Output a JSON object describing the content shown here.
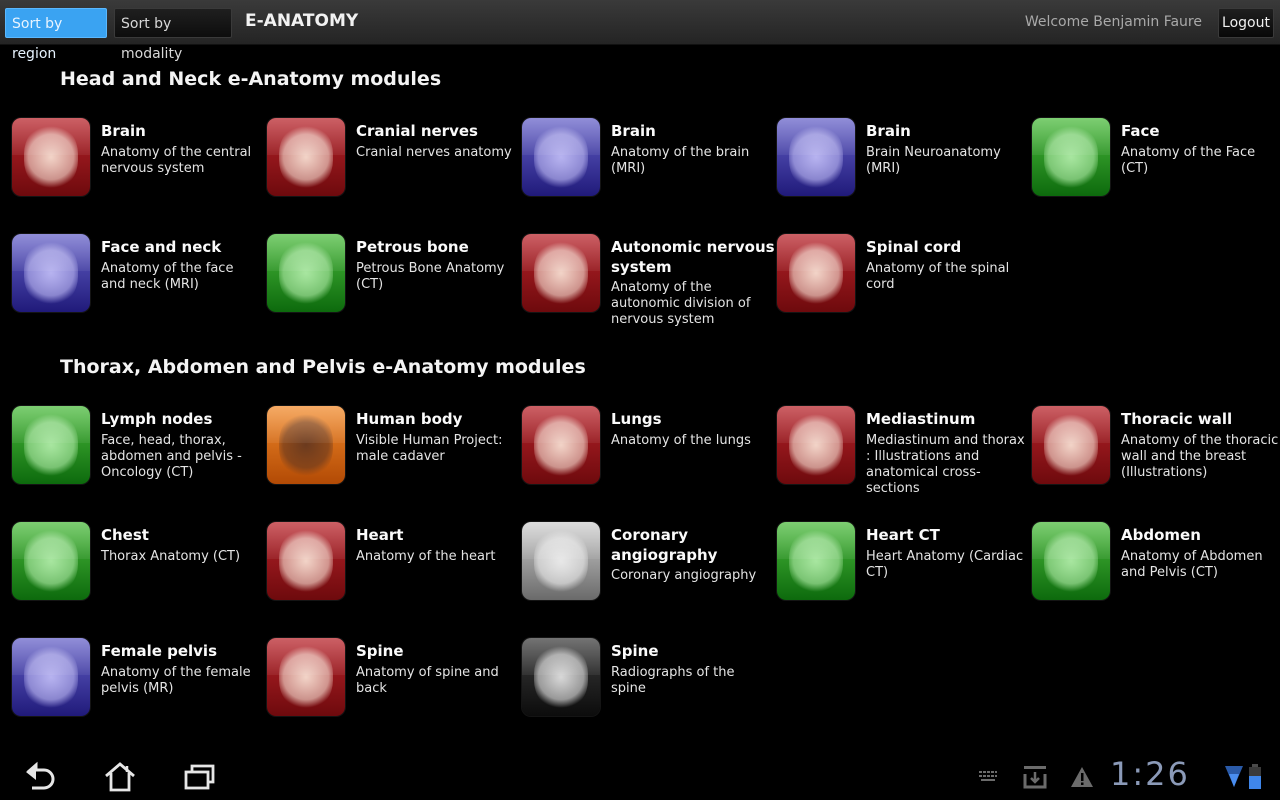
{
  "topbar": {
    "sort_by_region": "Sort by region",
    "sort_by_modality": "Sort by modality",
    "app_title": "E-ANATOMY",
    "welcome": "Welcome Benjamin Faure",
    "logout": "Logout",
    "active_tab_color": "#3aa3f2"
  },
  "sections": [
    {
      "title": "Head and Neck e-Anatomy modules",
      "modules": [
        {
          "title": "Brain",
          "desc": "Anatomy of the central nervous system",
          "icon": "brain-illustration-icon",
          "color": "red"
        },
        {
          "title": "Cranial nerves",
          "desc": "Cranial nerves anatomy",
          "icon": "cranial-nerves-icon",
          "color": "red"
        },
        {
          "title": "Brain",
          "desc": "Anatomy of the brain (MRI)",
          "icon": "brain-mri-sagittal-icon",
          "color": "blue"
        },
        {
          "title": "Brain",
          "desc": "Brain Neuroanatomy (MRI)",
          "icon": "brain-mri-axial-icon",
          "color": "blue"
        },
        {
          "title": "Face",
          "desc": "Anatomy of the Face (CT)",
          "icon": "face-ct-icon",
          "color": "green"
        },
        {
          "title": "Face and neck",
          "desc": "Anatomy of the face and neck (MRI)",
          "icon": "face-neck-mri-icon",
          "color": "blue"
        },
        {
          "title": "Petrous bone",
          "desc": "Petrous Bone Anatomy (CT)",
          "icon": "petrous-bone-ct-icon",
          "color": "green"
        },
        {
          "title": "Autonomic nervous system",
          "desc": "Anatomy of the autonomic division of nervous system",
          "icon": "autonomic-nervous-icon",
          "color": "red"
        },
        {
          "title": "Spinal cord",
          "desc": "Anatomy of the spinal cord",
          "icon": "spinal-cord-icon",
          "color": "red"
        }
      ]
    },
    {
      "title": "Thorax, Abdomen and Pelvis e-Anatomy modules",
      "modules": [
        {
          "title": "Lymph nodes",
          "desc": "Face, head, thorax, abdomen and pelvis - Oncology (CT)",
          "icon": "lymph-nodes-ct-icon",
          "color": "green"
        },
        {
          "title": "Human body",
          "desc": "Visible Human Project: male cadaver",
          "icon": "human-body-icon",
          "color": "orange"
        },
        {
          "title": "Lungs",
          "desc": "Anatomy of the lungs",
          "icon": "lungs-icon",
          "color": "red"
        },
        {
          "title": "Mediastinum",
          "desc": "Mediastinum and thorax : Illustrations and anatomical cross-sections",
          "icon": "mediastinum-icon",
          "color": "red"
        },
        {
          "title": "Thoracic wall",
          "desc": "Anatomy of the thoracic wall and the breast (Illustrations)",
          "icon": "thoracic-wall-icon",
          "color": "red"
        },
        {
          "title": "Chest",
          "desc": "Thorax Anatomy (CT)",
          "icon": "chest-ct-icon",
          "color": "green"
        },
        {
          "title": "Heart",
          "desc": "Anatomy of the heart",
          "icon": "heart-icon",
          "color": "red"
        },
        {
          "title": "Coronary angiography",
          "desc": "Coronary angiography",
          "icon": "coronary-angiography-icon",
          "color": "gray"
        },
        {
          "title": "Heart CT",
          "desc": "Heart Anatomy (Cardiac CT)",
          "icon": "heart-ct-icon",
          "color": "green"
        },
        {
          "title": "Abdomen",
          "desc": "Anatomy of Abdomen and Pelvis (CT)",
          "icon": "abdomen-ct-icon",
          "color": "green"
        },
        {
          "title": "Female pelvis",
          "desc": "Anatomy of the female pelvis (MR)",
          "icon": "female-pelvis-mr-icon",
          "color": "blue"
        },
        {
          "title": "Spine",
          "desc": "Anatomy of spine and back",
          "icon": "spine-illustration-icon",
          "color": "red"
        },
        {
          "title": "Spine",
          "desc": "Radiographs of the spine",
          "icon": "spine-radiograph-icon",
          "color": "black"
        }
      ]
    }
  ],
  "system_bar": {
    "clock": "1:26",
    "icons": [
      "back-icon",
      "home-icon",
      "recent-apps-icon",
      "keyboard-icon",
      "download-icon",
      "warning-icon",
      "wifi-icon",
      "battery-icon"
    ]
  }
}
